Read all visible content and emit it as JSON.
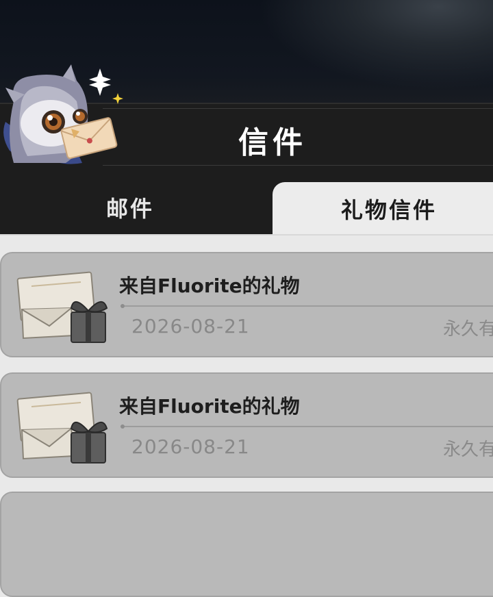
{
  "header": {
    "title": "信件",
    "mascot_icon": "owl-with-letter-icon"
  },
  "tabs": [
    {
      "label": "邮件",
      "active": false
    },
    {
      "label": "礼物信件",
      "active": true
    }
  ],
  "mail_list": [
    {
      "subject": "来自Fluorite的礼物",
      "date": "2026-08-21",
      "expiry": "永久有",
      "icon": "gift-envelope-icon"
    },
    {
      "subject": "来自Fluorite的礼物",
      "date": "2026-08-21",
      "expiry": "永久有",
      "icon": "gift-envelope-icon"
    }
  ],
  "colors": {
    "header_bg": "#1d1d1d",
    "active_tab_bg": "#ececec",
    "card_bg": "#b9b9b9",
    "sparkle": "#f3d23a"
  }
}
